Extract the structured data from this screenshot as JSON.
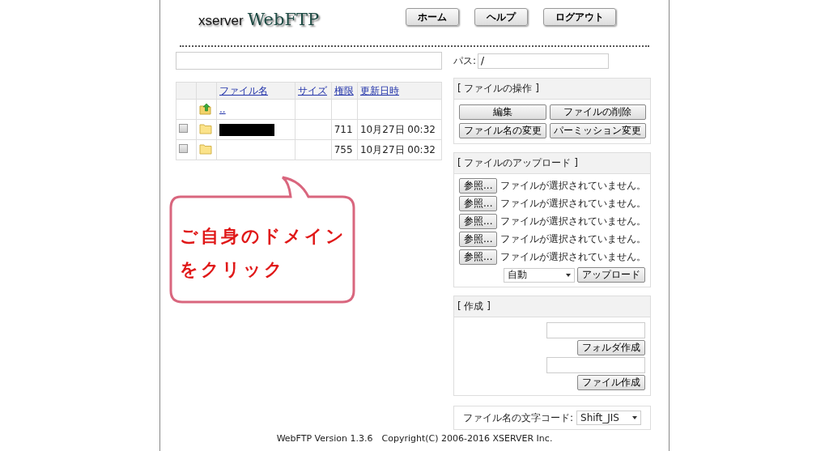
{
  "header": {
    "logo_small": "xserver",
    "logo_large": "WebFTP",
    "nav_buttons": [
      "ホーム",
      "ヘルプ",
      "ログアウト"
    ]
  },
  "top": {
    "path_label": "パス:",
    "path_value": "/"
  },
  "table": {
    "columns": [
      "ファイル名",
      "サイズ",
      "権限",
      "更新日時"
    ],
    "rows": [
      {
        "kind": "parent",
        "name": "..",
        "size": "",
        "perm": "",
        "date": ""
      },
      {
        "kind": "folder",
        "checked": false,
        "redacted": true,
        "size": "",
        "perm": "711",
        "date": "10月27日 00:32"
      },
      {
        "kind": "folder",
        "checked": false,
        "redacted": false,
        "size": "",
        "perm": "755",
        "date": "10月27日 00:32"
      }
    ]
  },
  "callout": {
    "lines": [
      "ご自身のドメイン",
      "をクリック"
    ]
  },
  "file_ops": {
    "title": "[ ファイルの操作 ]",
    "buttons": [
      "編集",
      "ファイルの削除",
      "ファイル名の変更",
      "パーミッション変更"
    ]
  },
  "upload": {
    "title": "[ ファイルのアップロード ]",
    "files": [
      {
        "button": "参照...",
        "status": "ファイルが選択されていません。"
      },
      {
        "button": "参照...",
        "status": "ファイルが選択されていません。"
      },
      {
        "button": "参照...",
        "status": "ファイルが選択されていません。"
      },
      {
        "button": "参照...",
        "status": "ファイルが選択されていません。"
      },
      {
        "button": "参照...",
        "status": "ファイルが選択されていません。"
      }
    ],
    "mode": "自動",
    "submit": "アップロード"
  },
  "create": {
    "title": "[ 作成 ]",
    "folder_button": "フォルダ作成",
    "file_button": "ファイル作成"
  },
  "encoding": {
    "label": "ファイル名の文字コード:",
    "value": "Shift_JIS"
  },
  "footer": "WebFTP Version 1.3.6　Copyright(C) 2006-2016 XSERVER Inc."
}
